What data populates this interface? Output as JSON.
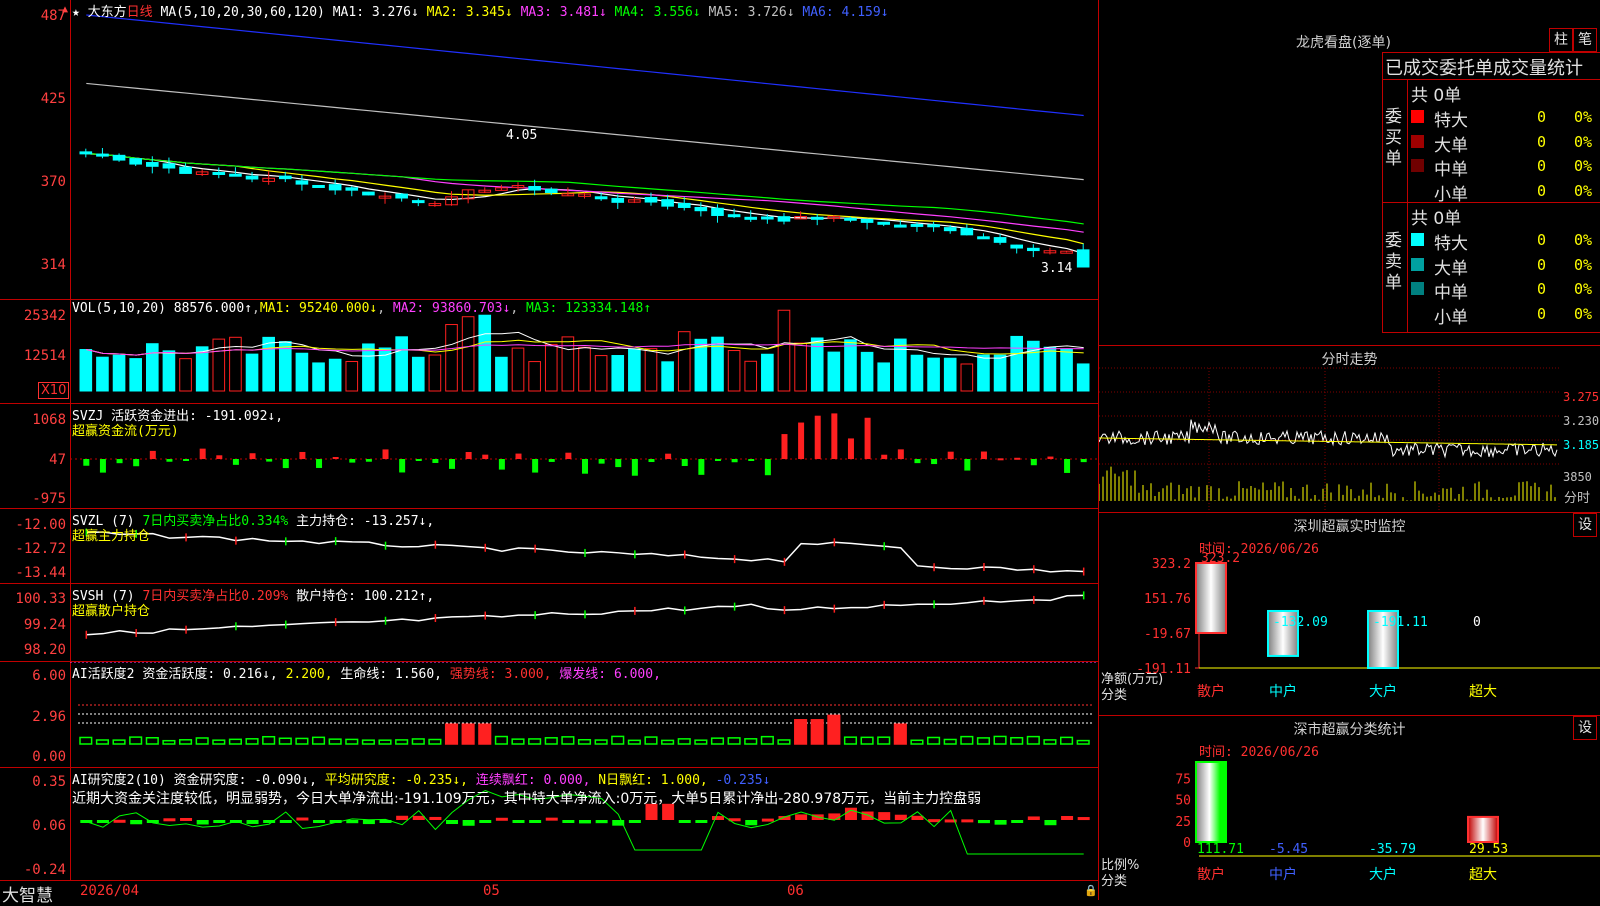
{
  "colors": {
    "up": "#ff2020",
    "down": "#00ffff",
    "ma1": "#ffffff",
    "ma2": "#ffff00",
    "ma3": "#ff40ff",
    "ma4": "#00ff00",
    "ma5": "#c0c0c0",
    "ma6": "#2030ff",
    "grid": "#c00000",
    "pos": "#ff2020",
    "neg": "#00ff00"
  },
  "chart": {
    "stock_name": "大东方",
    "period": "日线",
    "ma_label": "MA(5,10,20,30,60,120)",
    "ma_values": [
      {
        "label": "MA1:",
        "value": "3.276↓"
      },
      {
        "label": "MA2:",
        "value": "3.345↓"
      },
      {
        "label": "MA3:",
        "value": "3.481↓"
      },
      {
        "label": "MA4:",
        "value": "3.556↓"
      },
      {
        "label": "MA5:",
        "value": "3.726↓"
      },
      {
        "label": "MA6:",
        "value": "4.159↓"
      }
    ],
    "y_ticks": [
      "487",
      "425",
      "370",
      "314"
    ],
    "hi_label": "4.05",
    "lo_label": "3.14",
    "x_labels": [
      "2026/04",
      "05",
      "06"
    ]
  },
  "vol": {
    "label": "VOL(5,10,20)",
    "value": "88576.000↑",
    "ma1": "MA1: 95240.000↓",
    "ma2": "MA2: 93860.703↓",
    "ma3": "MA3: 123334.148↑",
    "y_ticks": [
      "25342",
      "12514"
    ],
    "unit": "X10"
  },
  "svzj": {
    "name": "SVZJ",
    "line1": "活跃资金进出: -191.092↓,",
    "line2": "超赢资金流(万元)",
    "y_ticks": [
      "1068",
      "47",
      "-975"
    ]
  },
  "svzl": {
    "name": "SVZL (7)",
    "part1": "7日内买卖净占比0.334%",
    "part2": "主力持仓: -13.257↓,",
    "line2": "超赢主力持仓",
    "y_ticks": [
      "-12.00",
      "-12.72",
      "-13.44"
    ]
  },
  "svsh": {
    "name": "SVSH (7)",
    "part1": "7日内买卖净占比0.209%",
    "part2": "散户持仓: 100.212↑,",
    "line2": "超赢散户持仓",
    "y_ticks": [
      "100.33",
      "99.24",
      "98.20"
    ]
  },
  "ai1": {
    "name": "AI活跃度2",
    "p1": "资金活跃度: 0.216↓,",
    "p2": "2.200,",
    "p3": "生命线: 1.560,",
    "p4": "强势线: 3.000,",
    "p5": "爆发线: 6.000,",
    "y_ticks": [
      "6.00",
      "2.96",
      "0.00"
    ]
  },
  "ai2": {
    "name": "AI研究度2(10)",
    "p1": "资金研究度: -0.090↓,",
    "p2": "平均研究度: -0.235↓,",
    "p3": "连续飘红: 0.000,",
    "p4": "N日飘红: 1.000,",
    "p5": "-0.235↓",
    "comment": "近期大资金关注度较低，明显弱势，今日大单净流出:-191.109万元，其中特大单净流入:0万元，大单5日累计净出-280.978万元，当前主力控盘弱",
    "y_ticks": [
      "0.35",
      "0.06",
      "-0.24"
    ]
  },
  "brand": "大智慧",
  "longhu": {
    "title": "龙虎看盘(逐单)",
    "btn1": "柱",
    "btn2": "笔",
    "subtitle": "已成交委托单成交量统计",
    "buy_group": "委买单",
    "buy_total": "共 0单",
    "buy_rows": [
      {
        "label": "特大",
        "count": "0",
        "pct": "0%",
        "color": "#ff0000"
      },
      {
        "label": "大单",
        "count": "0",
        "pct": "0%",
        "color": "#a00000"
      },
      {
        "label": "中单",
        "count": "0",
        "pct": "0%",
        "color": "#700000"
      },
      {
        "label": "小单",
        "count": "0",
        "pct": "0%",
        "color": "#000000"
      }
    ],
    "sell_group": "委卖单",
    "sell_total": "共 0单",
    "sell_rows": [
      {
        "label": "特大",
        "count": "0",
        "pct": "0%",
        "color": "#00ffff"
      },
      {
        "label": "大单",
        "count": "0",
        "pct": "0%",
        "color": "#00a0a0"
      },
      {
        "label": "中单",
        "count": "0",
        "pct": "0%",
        "color": "#008080"
      },
      {
        "label": "小单",
        "count": "0",
        "pct": "0%",
        "color": "#000000"
      }
    ]
  },
  "fenshi": {
    "title": "分时走势",
    "y_ticks": [
      "3.275",
      "3.230",
      "3.185"
    ],
    "vol_tick": "3850",
    "vol_label": "分时"
  },
  "monitor": {
    "title": "深圳超赢实时监控",
    "btn": "设",
    "date": "时间: 2026/06/26",
    "y_ticks": [
      "323.2",
      "151.76",
      "-19.67",
      "-191.11"
    ],
    "y_title": "净额(万元)",
    "x_title": "分类",
    "categories": [
      "散户",
      "中户",
      "大户",
      "超大"
    ],
    "values": [
      323.2,
      -132.09,
      -191.11,
      0
    ],
    "value_labels": [
      "323.2",
      "-132.09",
      "-191.11",
      "0"
    ]
  },
  "stat": {
    "title": "深市超赢分类统计",
    "btn": "设",
    "date": "时间: 2026/06/26",
    "y_ticks": [
      "75",
      "50",
      "25",
      "0"
    ],
    "y_title": "比例%",
    "x_title": "分类",
    "categories": [
      "散户",
      "中户",
      "大户",
      "超大"
    ],
    "values": [
      111.71,
      -5.45,
      -35.79,
      29.53
    ],
    "value_labels": [
      "111.71",
      "-5.45",
      "-35.79",
      "29.53"
    ]
  }
}
